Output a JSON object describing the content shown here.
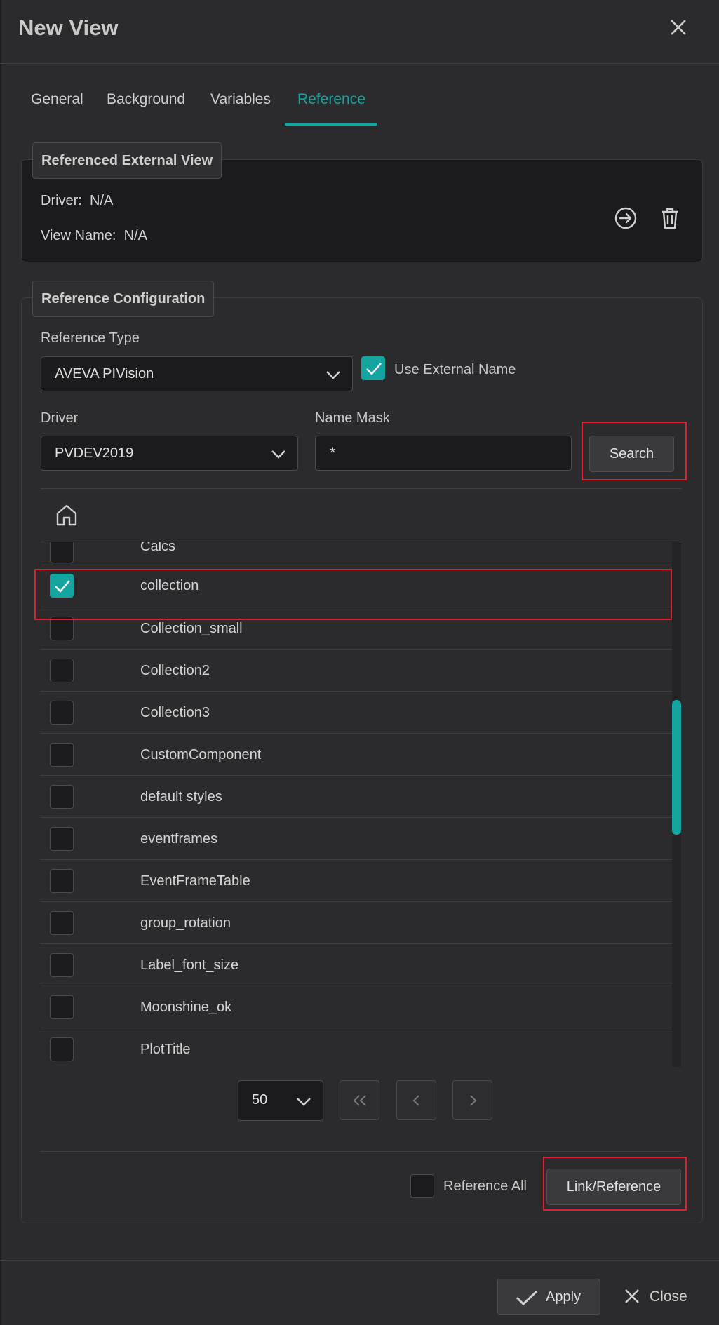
{
  "dialog": {
    "title": "New View",
    "tabs": [
      "General",
      "Background",
      "Variables",
      "Reference"
    ],
    "active_tab": "Reference"
  },
  "external_view": {
    "legend": "Referenced External View",
    "driver_label": "Driver:",
    "driver_value": "N/A",
    "view_name_label": "View Name:",
    "view_name_value": "N/A",
    "icons": [
      "navigate-icon",
      "trash-icon"
    ]
  },
  "config": {
    "legend": "Reference Configuration",
    "reference_type_label": "Reference Type",
    "reference_type_value": "AVEVA PIVision",
    "use_external_name_label": "Use External Name",
    "use_external_name_checked": true,
    "driver_label": "Driver",
    "driver_value": "PVDEV2019",
    "name_mask_label": "Name Mask",
    "name_mask_value": "*",
    "search_label": "Search"
  },
  "list": {
    "home_icon": "home-icon",
    "items": [
      {
        "name": "Calcs",
        "checked": false
      },
      {
        "name": "collection",
        "checked": true
      },
      {
        "name": "Collection_small",
        "checked": false
      },
      {
        "name": "Collection2",
        "checked": false
      },
      {
        "name": "Collection3",
        "checked": false
      },
      {
        "name": "CustomComponent",
        "checked": false
      },
      {
        "name": "default styles",
        "checked": false
      },
      {
        "name": "eventframes",
        "checked": false
      },
      {
        "name": "EventFrameTable",
        "checked": false
      },
      {
        "name": "group_rotation",
        "checked": false
      },
      {
        "name": "Label_font_size",
        "checked": false
      },
      {
        "name": "Moonshine_ok",
        "checked": false
      },
      {
        "name": "PlotTitle",
        "checked": false
      }
    ]
  },
  "pager": {
    "page_size": "50",
    "buttons": [
      "first-page-icon",
      "prev-page-icon",
      "next-page-icon"
    ]
  },
  "actions": {
    "reference_all_label": "Reference All",
    "link_reference_label": "Link/Reference"
  },
  "footer": {
    "apply_label": "Apply",
    "close_label": "Close"
  },
  "colors": {
    "accent": "#14a5a0",
    "highlight": "#e02030",
    "background": "#2b2b2d"
  }
}
